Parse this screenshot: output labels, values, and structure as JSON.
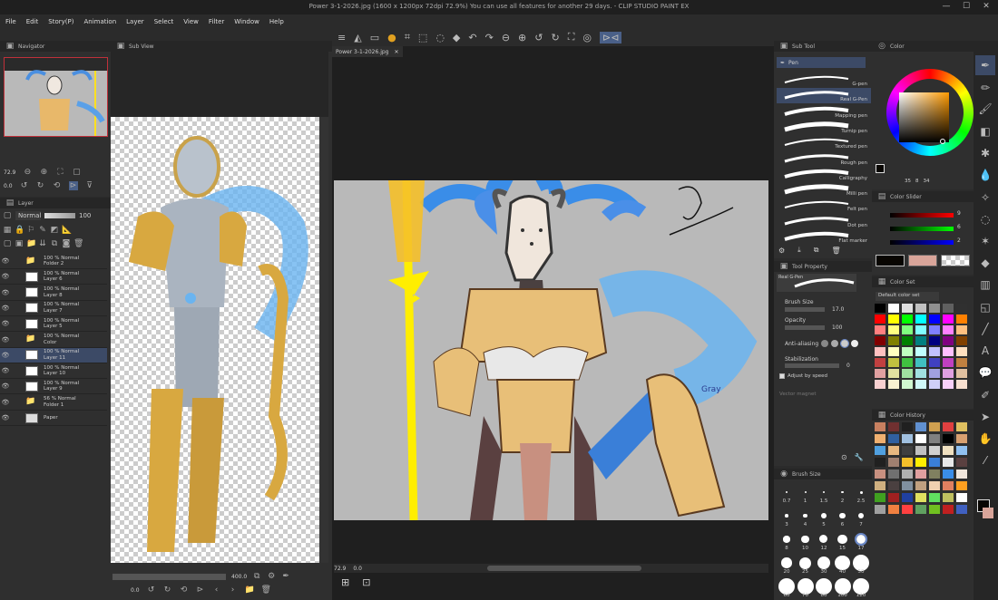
{
  "titlebar": {
    "title": "Power 3-1-2026.jpg (1600 x 1200px 72dpi 72.9%)  You can use all features for another 29 days. - CLIP STUDIO PAINT EX",
    "minimize": "—",
    "maximize": "☐",
    "close": "✕"
  },
  "menu": [
    "File",
    "Edit",
    "Story(P)",
    "Animation",
    "Layer",
    "Select",
    "View",
    "Filter",
    "Window",
    "Help"
  ],
  "navigator": {
    "tab": "Navigator",
    "zoom": "72.9",
    "angle": "0.0"
  },
  "subview": {
    "tab": "Sub View",
    "zoom": "400.0",
    "angle": "0.0"
  },
  "layer_panel": {
    "tab": "Layer",
    "blend": "Normal",
    "opacity": "100",
    "layers": [
      {
        "line1": "100 % Normal",
        "line2": "Folder 2",
        "type": "folder"
      },
      {
        "line1": "100 % Normal",
        "line2": "Layer 6",
        "type": "layer"
      },
      {
        "line1": "100 % Normal",
        "line2": "Layer 8",
        "type": "layer"
      },
      {
        "line1": "100 % Normal",
        "line2": "Layer 7",
        "type": "layer"
      },
      {
        "line1": "100 % Normal",
        "line2": "Layer 5",
        "type": "layer"
      },
      {
        "line1": "100 % Normal",
        "line2": "Color",
        "type": "folder"
      },
      {
        "line1": "100 % Normal",
        "line2": "Layer 11",
        "type": "layer",
        "selected": true
      },
      {
        "line1": "100 % Normal",
        "line2": "Layer 10",
        "type": "layer"
      },
      {
        "line1": "100 % Normal",
        "line2": "Layer 9",
        "type": "layer"
      },
      {
        "line1": "56 % Normal",
        "line2": "Folder 1",
        "type": "folder"
      },
      {
        "line1": "",
        "line2": "Paper",
        "type": "paper"
      }
    ]
  },
  "canvas": {
    "tab": "Power 3-1-2026.jpg",
    "zoom": "72.9",
    "angle": "0.0",
    "bg": "#b9b9b9",
    "signature": "Gray"
  },
  "subtool": {
    "tab": "Sub Tool",
    "group": "Pen",
    "brushes": [
      "G-pen",
      "Real G-Pen",
      "Mapping pen",
      "Turnip pen",
      "Textured pen",
      "Rough pen",
      "Calligraphy",
      "Milli pen",
      "Felt pen",
      "Dot pen",
      "Flat marker"
    ],
    "selected": "Real G-Pen"
  },
  "toolprop": {
    "tab": "Tool Property",
    "preview": "Real G-Pen",
    "brush_size_label": "Brush Size",
    "brush_size": "17.0",
    "opacity_label": "Opacity",
    "opacity": "100",
    "antialias_label": "Anti-aliasing",
    "stabilization_label": "Stabilization",
    "stabilization": "0",
    "adjust_label": "Adjust by speed",
    "vector_label": "Vector magnet"
  },
  "brushsize": {
    "tab": "Brush Size",
    "sizes": [
      "0.7",
      "1",
      "1.5",
      "2",
      "2.5",
      "3",
      "4",
      "5",
      "6",
      "7",
      "8",
      "10",
      "12",
      "15",
      "17",
      "20",
      "25",
      "30",
      "40",
      "50",
      "60",
      "70",
      "80",
      "100",
      "120"
    ],
    "selected": "17"
  },
  "color": {
    "tab": "Color",
    "h": "35",
    "s": "8",
    "v": "34",
    "slider_tab": "Color Slider",
    "r": "9",
    "g": "6",
    "b": "2",
    "main": "#090602",
    "sub": "#d9a59a",
    "set_tab": "Color Set",
    "set_name": "Default color set",
    "history_tab": "Color History"
  }
}
